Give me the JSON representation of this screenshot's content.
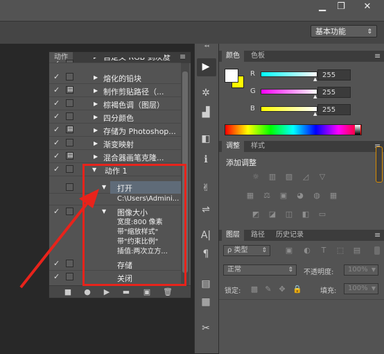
{
  "window": {
    "minimize": "▁",
    "restore": "❐",
    "close": "✕"
  },
  "workspace": {
    "label": "基本功能",
    "arrow": "⇕"
  },
  "actions_panel": {
    "tab": "动作",
    "collapse": "▸▸",
    "menu": "≡",
    "rows": [
      {
        "label": "自定义 RGB 到灰度",
        "check": "✓",
        "dialog": "",
        "expand": "▶"
      },
      {
        "label": "熔化的铅块",
        "check": "✓",
        "dialog": "",
        "expand": "▶"
      },
      {
        "label": "制作剪贴路径（...",
        "check": "✓",
        "dialog": "▤",
        "expand": "▶"
      },
      {
        "label": "棕褐色调（图层）",
        "check": "✓",
        "dialog": "",
        "expand": "▶"
      },
      {
        "label": "四分颜色",
        "check": "✓",
        "dialog": "",
        "expand": "▶"
      },
      {
        "label": "存储为 Photoshop...",
        "check": "✓",
        "dialog": "▤",
        "expand": "▶"
      },
      {
        "label": "渐变映射",
        "check": "✓",
        "dialog": "",
        "expand": "▶"
      },
      {
        "label": "混合器画笔克隆...",
        "check": "✓",
        "dialog": "▤",
        "expand": "▶"
      },
      {
        "label": "动作 1",
        "check": "✓",
        "dialog": "",
        "expand": "▼"
      }
    ],
    "open_step": {
      "label": "打开",
      "check": "",
      "expand": "▼",
      "detail": "C:\\Users\\Admini..."
    },
    "resize_step": {
      "label": "图像大小",
      "check": "✓",
      "expand": "▼",
      "details": [
        "宽度:800 像素",
        "带\"缩放样式\"",
        "带\"约束比例\"",
        "插值:两次立方..."
      ]
    },
    "save_step": {
      "label": "存储",
      "check": "✓"
    },
    "close_step": {
      "label": "关闭",
      "check": "✓"
    },
    "footer_icons": [
      "■",
      "●",
      "▶",
      "▬",
      "▣",
      "🗑"
    ]
  },
  "color_panel": {
    "tabs": [
      "颜色",
      "色板"
    ],
    "channels": [
      {
        "name": "R",
        "value": "255"
      },
      {
        "name": "G",
        "value": "255"
      },
      {
        "name": "B",
        "value": "255"
      }
    ]
  },
  "adjustments_panel": {
    "tabs": [
      "调整",
      "样式"
    ],
    "title": "添加调整",
    "icons_row1": [
      "☼",
      "▥",
      "▨",
      "◿",
      "▽"
    ],
    "icons_row2": [
      "▦",
      "⚖",
      "▣",
      "◕",
      "◍",
      "▦"
    ],
    "icons_row3": [
      "◩",
      "◪",
      "◫",
      "◧",
      "▭"
    ]
  },
  "layers_panel": {
    "tabs": [
      "图层",
      "路径",
      "历史记录"
    ],
    "filter": "ρ 类型",
    "filter_arrow": "⇕",
    "filter_icons": [
      "▣",
      "◐",
      "T",
      "⬚",
      "▤"
    ],
    "blend_mode": "正常",
    "opacity_label": "不透明度:",
    "opacity_value": "100%",
    "lock_label": "锁定:",
    "lock_icons": [
      "▩",
      "✎",
      "✥",
      "🔒"
    ],
    "fill_label": "填充:",
    "fill_value": "100%"
  },
  "toolbar_icons": [
    "▶",
    "✲",
    "▟",
    "◧",
    "ℹ",
    "✌",
    "⇌",
    "A|",
    "¶",
    "▤",
    "▦",
    "✂"
  ]
}
